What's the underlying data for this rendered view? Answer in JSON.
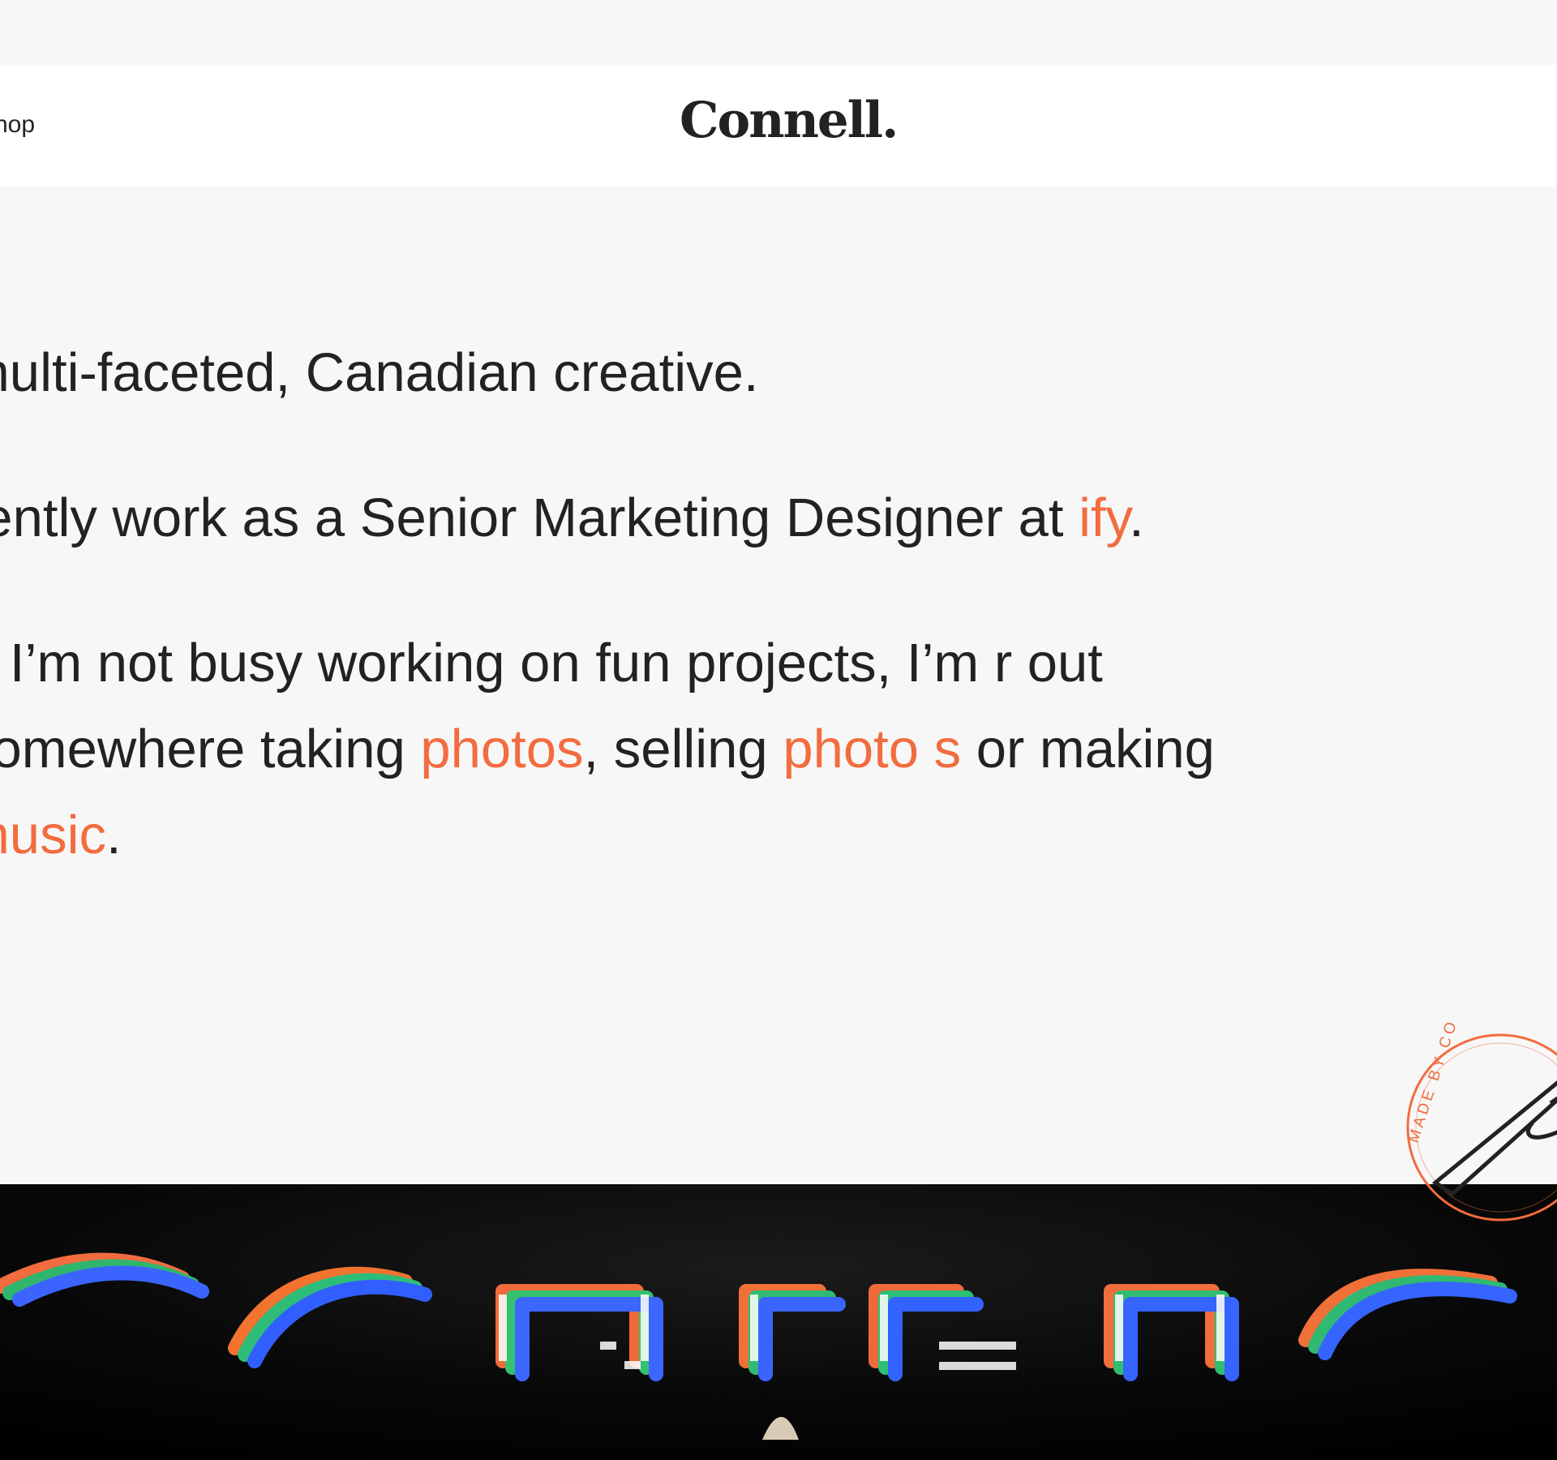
{
  "header": {
    "nav_shop": "hop",
    "logo": "Connell."
  },
  "intro": {
    "line1": "multi-faceted, Canadian creative.",
    "para2_prefix": "rently work as a Senior Marketing Designer at ",
    "para2_link": "ify",
    "para2_suffix": ".",
    "para3_prefix": "n I’m not busy working on fun projects, I’m r out somewhere taking ",
    "para3_link1": "photos",
    "para3_middle": ", selling ",
    "para3_link2": "photo s",
    "para3_middle2": " or making ",
    "para3_link3": "music",
    "para3_suffix": "."
  },
  "stamp": {
    "text": "MADE BY CONNELL MCCARTHY"
  },
  "colors": {
    "accent": "#f26c3f",
    "text": "#222222",
    "background": "#f7f7f7",
    "header_bg": "#ffffff",
    "hero_bg": "#050505"
  }
}
